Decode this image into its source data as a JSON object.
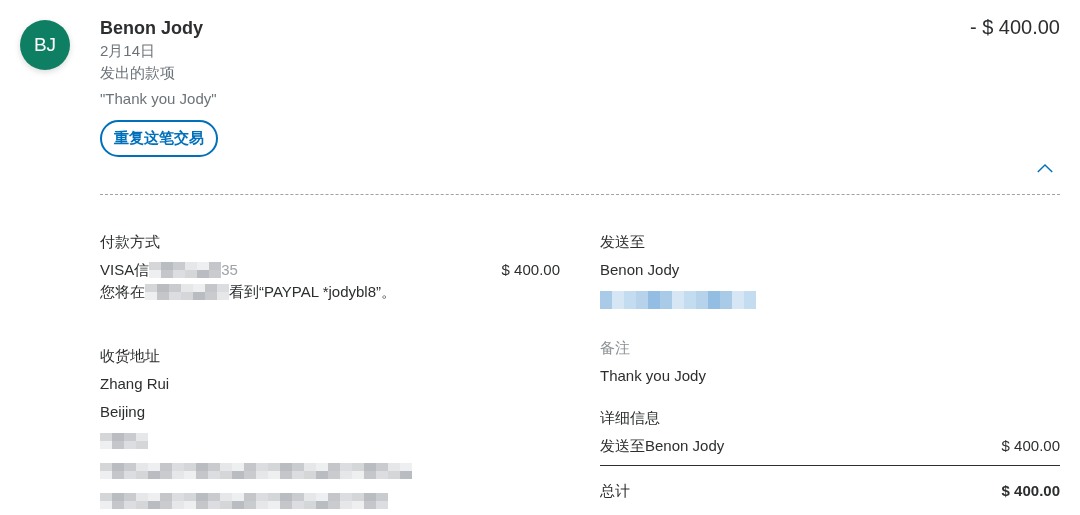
{
  "header": {
    "avatar_initials": "BJ",
    "name": "Benon Jody",
    "date": "2月14日",
    "type": "发出的款项",
    "note": "\"Thank you Jody\"",
    "amount": "- $ 400.00",
    "repeat_button": "重复这笔交易",
    "expanded": true
  },
  "payment_method": {
    "title": "付款方式",
    "card_prefix": "VISA信",
    "card_suffix": "35",
    "amount": "$ 400.00",
    "statement_prefix": "您将在",
    "statement_suffix": "看到“PAYPAL *jodybl8”。"
  },
  "shipping_address": {
    "title": "收货地址",
    "lines": [
      "Zhang Rui",
      "Beijing"
    ]
  },
  "sent_to": {
    "title": "发送至",
    "name": "Benon Jody"
  },
  "memo": {
    "title": "备注",
    "text": "Thank you Jody"
  },
  "details": {
    "title": "详细信息",
    "rows": [
      {
        "label": "发送至Benon Jody",
        "amount": "$ 400.00"
      }
    ],
    "total_label": "总计",
    "total": "$ 400.00"
  }
}
